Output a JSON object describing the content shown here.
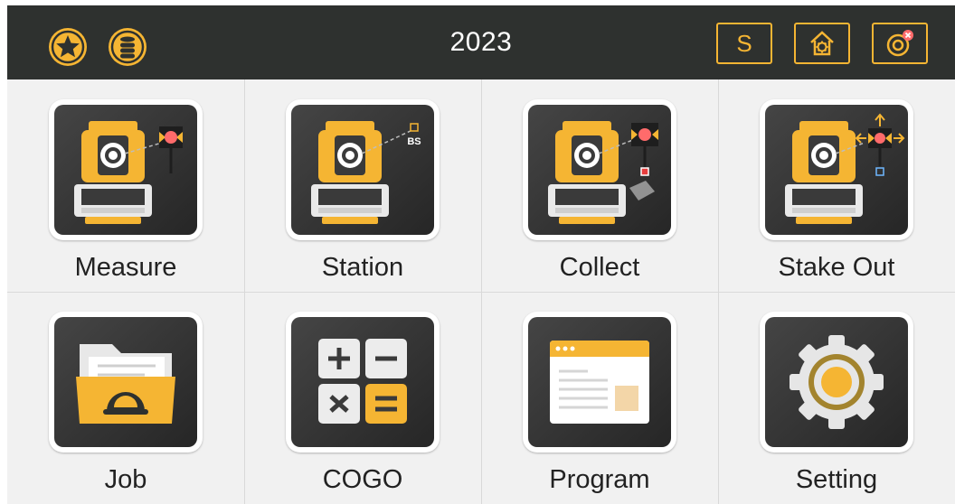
{
  "header": {
    "title": "2023",
    "favorites_icon": "star-icon",
    "database_icon": "database-stack-icon",
    "s_button_label": "S",
    "home_icon": "home-settings-icon",
    "target_icon": "prism-disconnected-icon"
  },
  "tiles": [
    {
      "label": "Measure",
      "icon": "total-station-measure-icon"
    },
    {
      "label": "Station",
      "icon": "total-station-backsight-icon"
    },
    {
      "label": "Collect",
      "icon": "total-station-collect-icon"
    },
    {
      "label": "Stake Out",
      "icon": "total-station-stakeout-icon"
    },
    {
      "label": "Job",
      "icon": "job-folder-icon"
    },
    {
      "label": "COGO",
      "icon": "calculator-icon"
    },
    {
      "label": "Program",
      "icon": "program-window-icon"
    },
    {
      "label": "Setting",
      "icon": "gear-icon"
    }
  ],
  "station_icon_text": "BS",
  "colors": {
    "header_bg": "#2e312f",
    "accent": "#f5b533",
    "tile_dark": "#3a3a3a",
    "grid_bg": "#f1f1f1",
    "target_red": "#ff6b6b"
  }
}
